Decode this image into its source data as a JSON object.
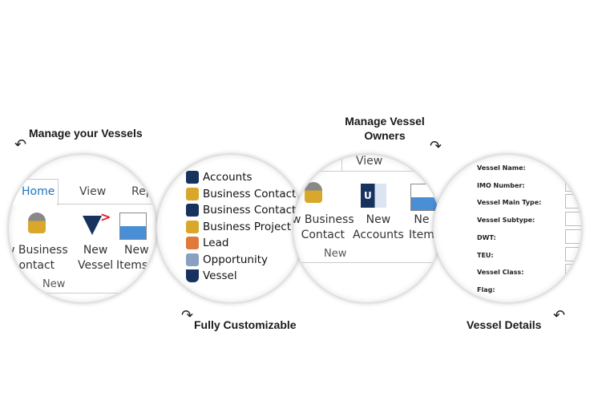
{
  "captions": {
    "c1": "Manage your Vessels",
    "c2": "Fully Customizable",
    "c3": "Manage Vessel Owners",
    "c4": "Vessel Details"
  },
  "circle1": {
    "tabs": [
      "Home",
      "View",
      "Repo"
    ],
    "buttons": [
      {
        "label1": "w Business",
        "label2": "ontact",
        "icon": "business-contact-icon"
      },
      {
        "label1": "New",
        "label2": "Vessel",
        "icon": "vessel-icon"
      },
      {
        "label1": "New",
        "label2": "Items ▾",
        "icon": "new-items-icon"
      }
    ],
    "group": "New"
  },
  "circle2": {
    "items": [
      {
        "label": "Accounts",
        "icon": "accounts-icon"
      },
      {
        "label": "Business Contact",
        "icon": "business-contact-icon"
      },
      {
        "label": "Business Contact",
        "icon": "business-contact-link-icon"
      },
      {
        "label": "Business Project",
        "icon": "business-project-icon"
      },
      {
        "label": "Lead",
        "icon": "lead-icon"
      },
      {
        "label": "Opportunity",
        "icon": "opportunity-icon"
      },
      {
        "label": "Vessel",
        "icon": "vessel-icon"
      }
    ]
  },
  "circle3": {
    "tabs": [
      "View"
    ],
    "buttons": [
      {
        "label1": "w Business",
        "label2": "Contact"
      },
      {
        "label1": "New",
        "label2": "Accounts"
      },
      {
        "label1": "Ne",
        "label2": "Item"
      }
    ],
    "group": "New"
  },
  "circle4": {
    "fields": [
      "Vessel Name:",
      "IMO Number:",
      "Vessel Main Type:",
      "Vessel Subtype:",
      "DWT:",
      "TEU:",
      "Vessel Class:",
      "Flag:"
    ]
  },
  "colors": {
    "accent": "#1e73be",
    "navy": "#17325e",
    "red": "#e21b23",
    "gold": "#d9a82a"
  }
}
